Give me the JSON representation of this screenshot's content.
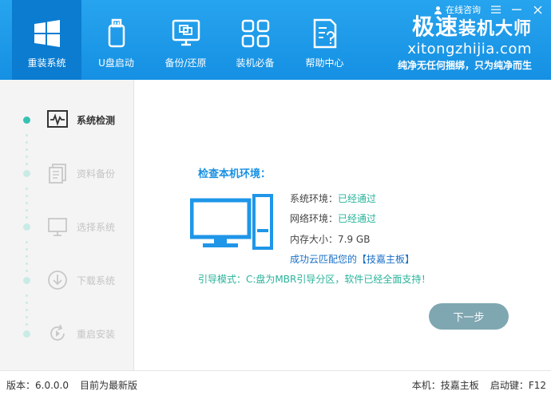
{
  "nav": [
    {
      "label": "重装系统",
      "icon": "windows-icon",
      "active": true
    },
    {
      "label": "U盘启动",
      "icon": "usb-icon"
    },
    {
      "label": "备份/还原",
      "icon": "backup-icon"
    },
    {
      "label": "装机必备",
      "icon": "apps-grid-icon"
    },
    {
      "label": "帮助中心",
      "icon": "help-doc-icon"
    }
  ],
  "topbar": {
    "consult": "在线咨询",
    "menu_icon": "menu-icon",
    "minimize_icon": "minimize-icon",
    "close_icon": "close-icon"
  },
  "brand": {
    "title_part1": "极速",
    "title_part2": "装机大师",
    "url": "xitongzhijia.com",
    "slogan": "纯净无任何捆绑，只为纯净而生"
  },
  "steps": [
    {
      "label": "系统检测",
      "icon": "monitor-pulse-icon",
      "active": true
    },
    {
      "label": "资料备份",
      "icon": "documents-icon"
    },
    {
      "label": "选择系统",
      "icon": "monitor-icon"
    },
    {
      "label": "下载系统",
      "icon": "download-icon"
    },
    {
      "label": "重启安装",
      "icon": "restart-icon"
    }
  ],
  "main": {
    "check_title": "检查本机环境：",
    "sys_env_label": "系统环境：",
    "sys_env_value": "已经通过",
    "net_env_label": "网络环境：",
    "net_env_value": "已经通过",
    "mem_label": "内存大小：",
    "mem_value": "7.9 GB",
    "match_text": "成功云匹配您的【技嘉主板】",
    "boot_text": "引导模式：C:盘为MBR引导分区，软件已经全面支持！",
    "next_button": "下一步"
  },
  "footer": {
    "version": "版本：6.0.0.0",
    "latest": "目前为最新版",
    "machine": "本机：技嘉主板",
    "hotkey": "启动键：F12"
  },
  "colors": {
    "header": "#1a96e8",
    "accent_green": "#29b39a",
    "link_blue": "#1a6fc5",
    "next_button": "#7fa7b2"
  }
}
